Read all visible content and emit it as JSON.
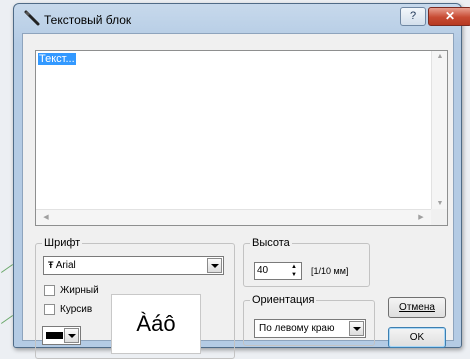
{
  "window": {
    "title": "Текстовый блок",
    "help_label": "?",
    "close_label": "✕"
  },
  "textarea": {
    "value": "Текст..."
  },
  "font_group": {
    "label": "Шрифт",
    "font_name": "Arial",
    "font_type_icon": "truetype-icon",
    "bold_label": "Жирный",
    "bold_checked": false,
    "italic_label": "Курсив",
    "italic_checked": false,
    "preview_text": "Àáô",
    "color": "#000000"
  },
  "height_group": {
    "label": "Высота",
    "value": "40",
    "unit": "[1/10 мм]"
  },
  "orientation_group": {
    "label": "Ориентация",
    "value": "По левому краю"
  },
  "buttons": {
    "cancel": "Отмена",
    "ok": "OK"
  }
}
